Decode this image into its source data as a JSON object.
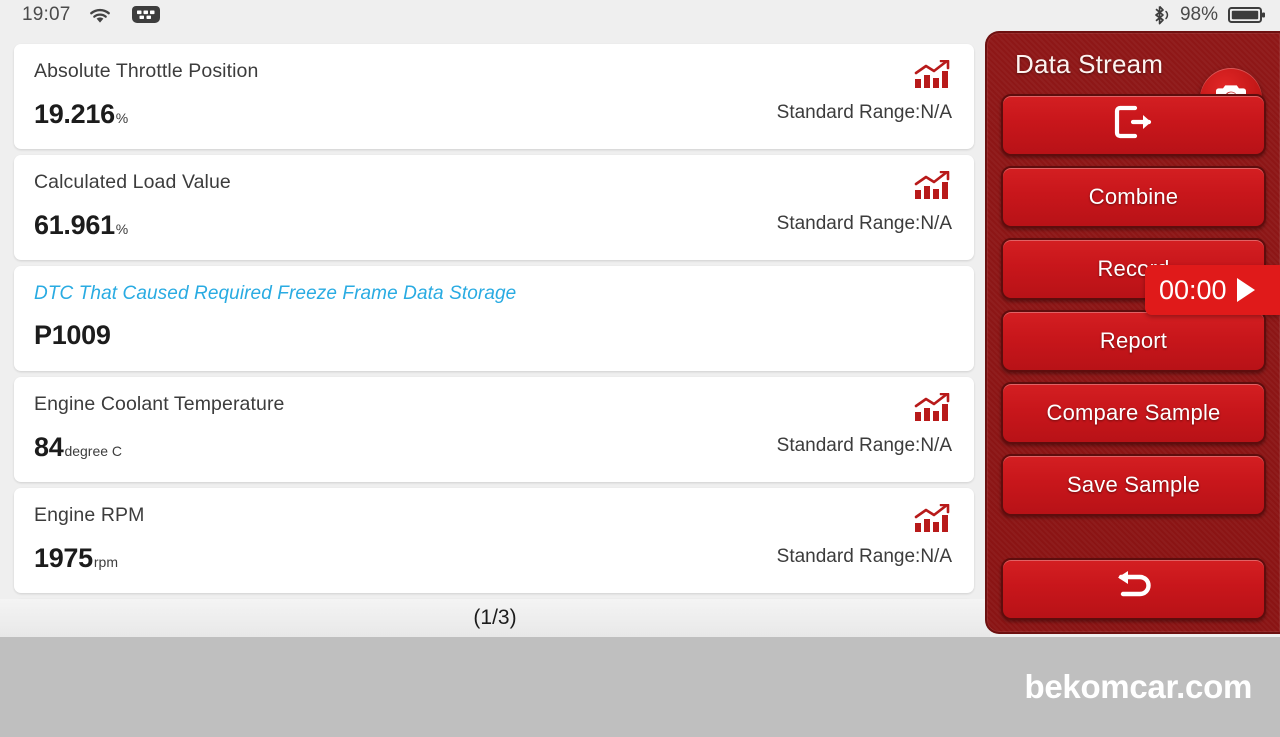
{
  "status_bar": {
    "time": "19:07",
    "wifi_icon": "wifi-icon",
    "obd_icon": "obd-connector-icon",
    "bluetooth_icon": "bluetooth-icon",
    "battery_percent": "98%",
    "battery_icon": "battery-icon"
  },
  "list": {
    "pagination": "(1/3)",
    "range_label": "Standard Range:N/A",
    "chart_icon": "bar-chart-icon",
    "items": [
      {
        "name": "Absolute Throttle Position",
        "value": "19.216",
        "unit": "%",
        "range": "Standard Range:N/A",
        "has_chart": true,
        "is_dtc": false
      },
      {
        "name": "Calculated Load Value",
        "value": "61.961",
        "unit": "%",
        "range": "Standard Range:N/A",
        "has_chart": true,
        "is_dtc": false
      },
      {
        "name": "DTC That Caused Required Freeze Frame Data Storage",
        "value": "P1009",
        "unit": "",
        "range": "",
        "has_chart": false,
        "is_dtc": true
      },
      {
        "name": "Engine Coolant Temperature",
        "value": "84",
        "unit": "degree C",
        "range": "Standard Range:N/A",
        "has_chart": true,
        "is_dtc": false
      },
      {
        "name": "Engine RPM",
        "value": "1975",
        "unit": "rpm",
        "range": "Standard Range:N/A",
        "has_chart": true,
        "is_dtc": false
      }
    ]
  },
  "panel": {
    "title": "Data Stream",
    "camera_icon": "camera-icon",
    "exit_icon": "exit-icon",
    "back_icon": "back-arrow-icon",
    "buttons": [
      {
        "label": "",
        "icon": "exit-icon"
      },
      {
        "label": "Combine",
        "icon": ""
      },
      {
        "label": "Record",
        "icon": ""
      },
      {
        "label": "Report",
        "icon": ""
      },
      {
        "label": "Compare Sample",
        "icon": ""
      },
      {
        "label": "Save Sample",
        "icon": ""
      }
    ],
    "timer": {
      "elapsed": "00:00",
      "play_icon": "play-icon"
    }
  },
  "footer": {
    "watermark": "bekomcar.com"
  },
  "colors": {
    "panel_bg": "#8e1717",
    "button_red": "#c8161b",
    "timer_red": "#e01a1a",
    "dtc_cyan": "#29abe2",
    "chart_icon_red": "#b81a1a",
    "footer_gray": "#bfbfbf",
    "page_bg": "#efefef"
  }
}
